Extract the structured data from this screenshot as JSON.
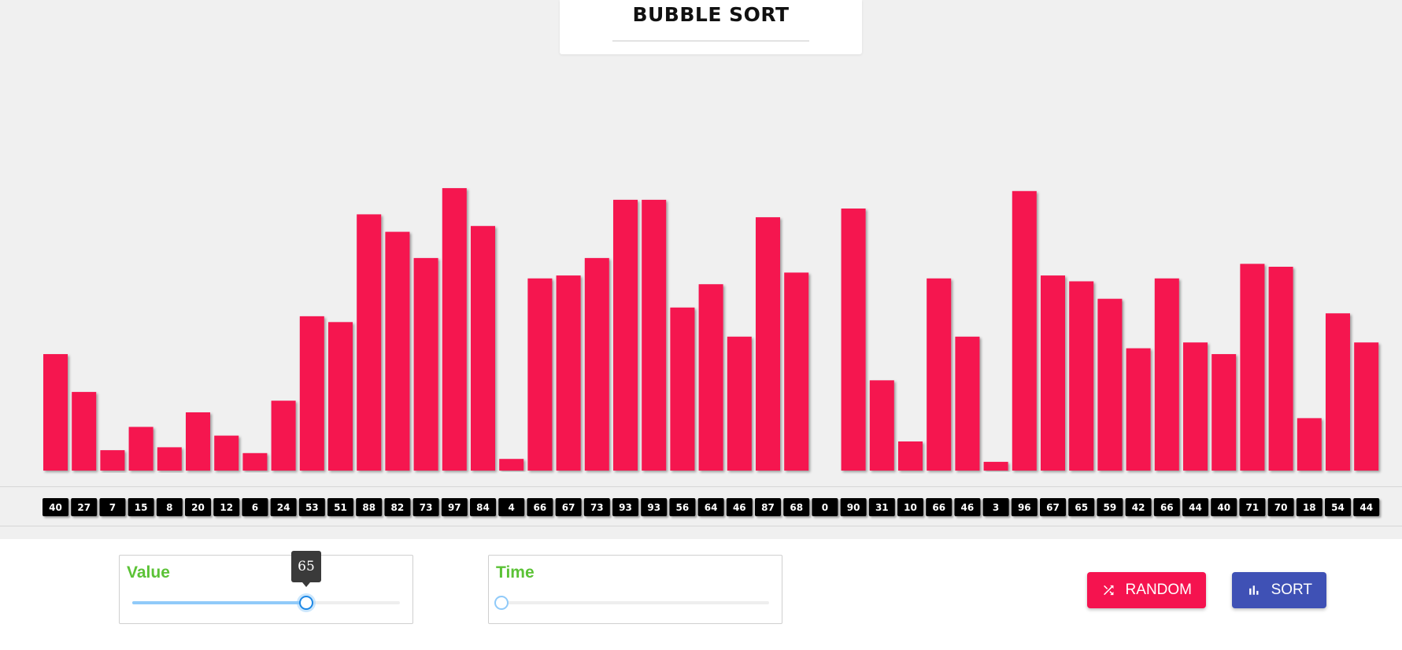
{
  "header": {
    "title": "BUBBLE SORT"
  },
  "colors": {
    "bar": "#f5134f",
    "label_bg": "#000000",
    "label_text": "#ffffff",
    "slider_label": "#5bc236",
    "random_button": "#f5134f",
    "sort_button": "#3f51b5"
  },
  "chart_data": {
    "type": "bar",
    "ylim": [
      0,
      100
    ],
    "values": [
      40,
      27,
      7,
      15,
      8,
      20,
      12,
      6,
      24,
      53,
      51,
      88,
      82,
      73,
      97,
      84,
      4,
      66,
      67,
      73,
      93,
      93,
      56,
      64,
      46,
      87,
      68,
      0,
      90,
      31,
      10,
      66,
      46,
      3,
      96,
      67,
      65,
      59,
      42,
      66,
      44,
      40,
      71,
      70,
      18,
      54,
      44
    ],
    "grid": false,
    "legend": "none"
  },
  "controls": {
    "value_slider": {
      "label": "Value",
      "value": 65,
      "min": 0,
      "max": 100
    },
    "time_slider": {
      "label": "Time",
      "value": 0,
      "min": 0,
      "max": 100
    },
    "random_button": {
      "label": "RANDOM",
      "icon": "shuffle-icon"
    },
    "sort_button": {
      "label": "SORT",
      "icon": "bar-chart-icon"
    }
  }
}
